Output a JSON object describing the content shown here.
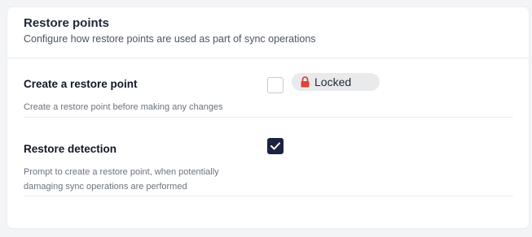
{
  "panel": {
    "title": "Restore points",
    "subtitle": "Configure how restore points are used as part of sync operations"
  },
  "settings": [
    {
      "label": "Create a restore point",
      "description": "Create a restore point before making any changes",
      "checked": false,
      "badge": {
        "text": "Locked",
        "icon": "lock-icon",
        "icon_color": "#e0413a"
      }
    },
    {
      "label": "Restore detection",
      "description": "Prompt to create a restore point, when potentially damaging sync operations are performed",
      "checked": true
    }
  ],
  "colors": {
    "checkbox_checked": "#1c2340",
    "badge_background": "#e9eaec",
    "lock_icon": "#e0413a"
  }
}
